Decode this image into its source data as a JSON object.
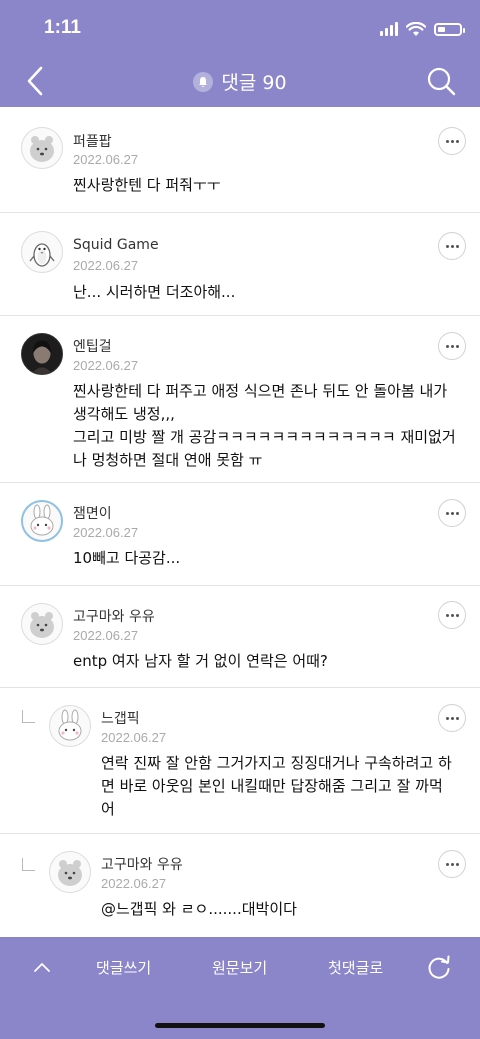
{
  "status": {
    "time": "1:11"
  },
  "header": {
    "title": "댓글 90"
  },
  "comments": [
    {
      "author": "퍼플팝",
      "date": "2022.06.27",
      "lines": [
        "찐사랑한텐 다 퍼줘ㅜㅜ"
      ]
    },
    {
      "author": "Squid Game",
      "date": "2022.06.27",
      "lines": [
        "난... 시러하면 더조아해..."
      ]
    },
    {
      "author": "엔팁걸",
      "date": "2022.06.27",
      "lines": [
        "찐사랑한테 다 퍼주고 애정 식으면 존나 뒤도 안 돌아봄 내가",
        "생각해도 냉정,,,",
        "그리고 미방 짤 개 공감ㅋㅋㅋㅋㅋㅋㅋㅋㅋㅋㅋㅋㅋ 재미없거",
        "나 멍청하면 절대 연애 못함 ㅠ"
      ]
    },
    {
      "author": "잼면이",
      "date": "2022.06.27",
      "lines": [
        "10빼고 다공감..."
      ]
    },
    {
      "author": "고구마와 우유",
      "date": "2022.06.27",
      "lines": [
        "entp 여자 남자 할 거 없이 연락은 어때?"
      ]
    },
    {
      "author": "느갭픽",
      "date": "2022.06.27",
      "lines": [
        "연락 진짜 잘 안함 그거가지고 징징대거나 구속하려고 하",
        "면 바로 아웃임  본인 내킬때만 답장해줌 그리고 잘 까먹",
        "어"
      ]
    },
    {
      "author": "고구마와 우유",
      "date": "2022.06.27",
      "lines": [
        "@느갭픽  와 ㄹㅇ.......대박이다"
      ]
    }
  ],
  "bottom": {
    "write": "댓글쓰기",
    "original": "원문보기",
    "first": "첫댓글로"
  },
  "colors": {
    "accent": "#8b86c9"
  }
}
